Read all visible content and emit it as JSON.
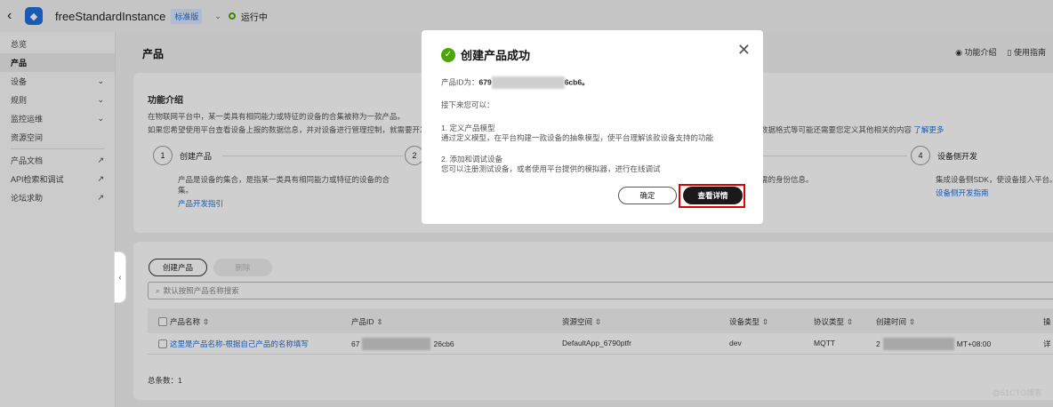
{
  "header": {
    "instance_name": "freeStandardInstance",
    "edition_tag": "标准版",
    "status": "运行中"
  },
  "sidebar": {
    "items": [
      {
        "label": "总览"
      },
      {
        "label": "产品"
      },
      {
        "label": "设备"
      },
      {
        "label": "规则"
      },
      {
        "label": "监控运维"
      },
      {
        "label": "资源空间"
      },
      {
        "label": "产品文档"
      },
      {
        "label": "API检索和调试"
      },
      {
        "label": "论坛求助"
      }
    ]
  },
  "page": {
    "title": "产品",
    "feature_intro": "功能介绍",
    "usage_guide": "使用指南"
  },
  "intro": {
    "heading": "功能介绍",
    "line1": "在物联网平台中，某一类具有相同能力或特征的设备的合集被称为一款产品。",
    "line2_left": "如果您希望使用平台查看设备上报的数据信息，并对设备进行管理控制，就需要开发",
    "line2_right": "数据格式等可能还需要您定义其他相关的内容",
    "learn_more": "了解更多",
    "steps": [
      {
        "num": "1",
        "title": "创建产品",
        "desc": "产品是设备的集合，是指某一类具有相同能力或特征的设备的合",
        "desc2": "集。",
        "link": "产品开发指引"
      },
      {
        "num": "2"
      },
      {
        "desc_fragment": "需的身份信息。"
      },
      {
        "num": "4",
        "title": "设备侧开发",
        "desc": "集成设备侧SDK，使设备接入平台。",
        "link": "设备侧开发指南"
      }
    ]
  },
  "list": {
    "create_button": "创建产品",
    "delete_button": "删除",
    "search_placeholder": "默认按照产品名称搜索",
    "columns": [
      "产品名称",
      "产品ID",
      "资源空间",
      "设备类型",
      "协议类型",
      "创建时间",
      "操"
    ],
    "rows": [
      {
        "name": "这里是产品名称-根据自己产品的名称填写",
        "id_prefix": "67",
        "id_suffix": "26cb6",
        "space": "DefaultApp_6790ptfr",
        "device_type": "dev",
        "protocol": "MQTT",
        "time_prefix": "2",
        "time_suffix": "MT+08:00",
        "action": "详"
      }
    ],
    "total": "总条数：1"
  },
  "modal": {
    "title": "创建产品成功",
    "id_label": "产品ID为：",
    "id_prefix": "679",
    "id_suffix": "6cb6。",
    "next": "接下来您可以：",
    "step1_title": "1. 定义产品模型",
    "step1_desc": "通过定义模型，在平台构建一款设备的抽象模型，使平台理解该款设备支持的功能",
    "step2_title": "2. 添加和调试设备",
    "step2_desc": "您可以注册测试设备，或者使用平台提供的模拟器，进行在线调试",
    "confirm": "确定",
    "view_details": "查看详情",
    "highlight_color": "#e00000"
  },
  "watermark": "@51CTO博客"
}
